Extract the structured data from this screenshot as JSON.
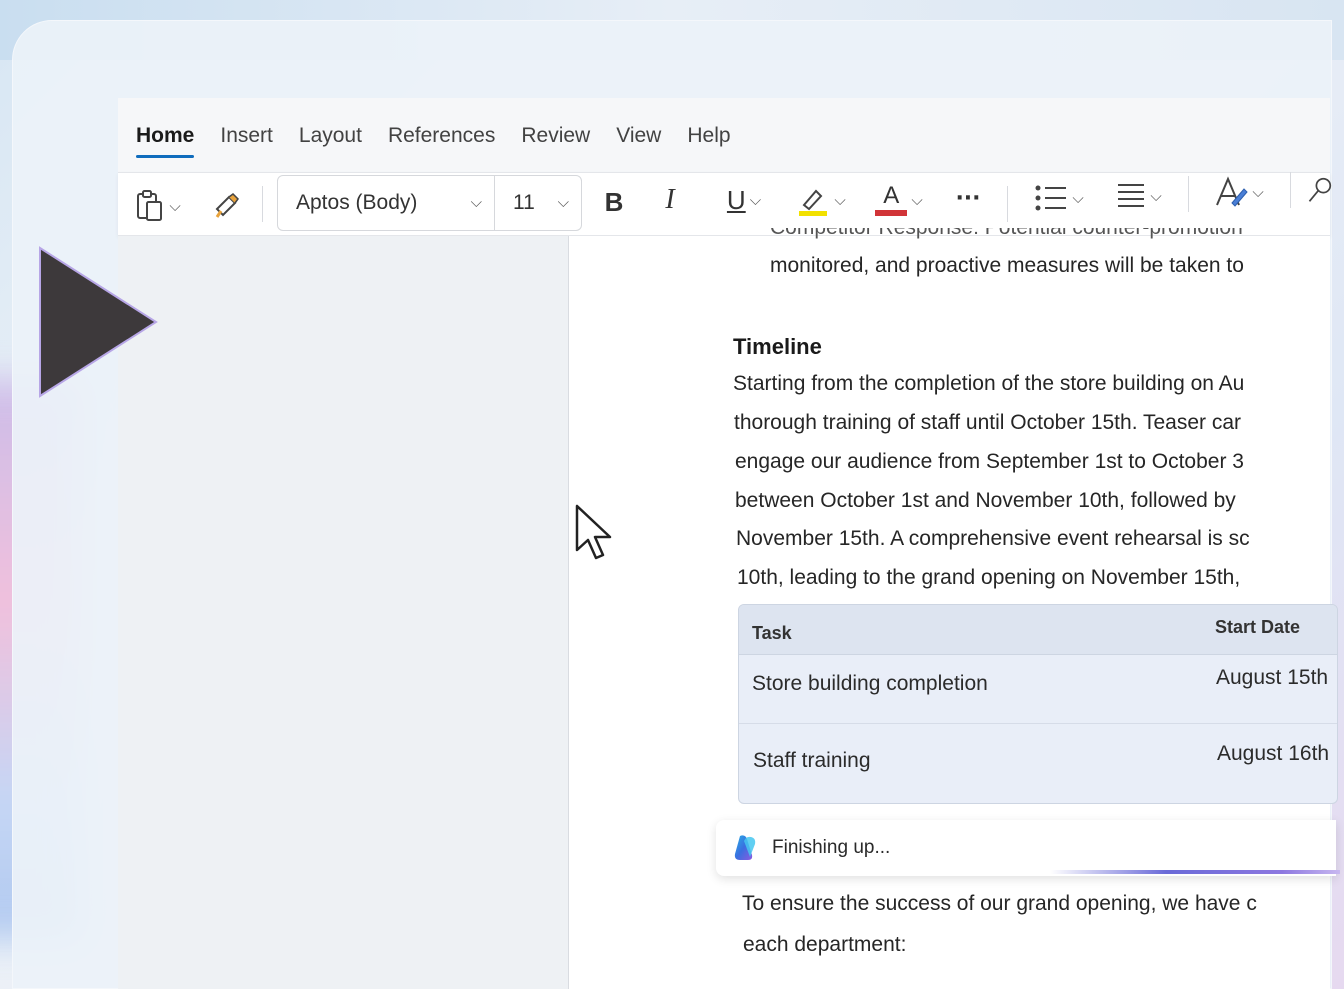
{
  "app": {
    "ribbon_tabs": [
      {
        "label": "Home",
        "active": true
      },
      {
        "label": "Insert",
        "active": false
      },
      {
        "label": "Layout",
        "active": false
      },
      {
        "label": "References",
        "active": false
      },
      {
        "label": "Review",
        "active": false
      },
      {
        "label": "View",
        "active": false
      },
      {
        "label": "Help",
        "active": false
      }
    ],
    "toolbar": {
      "font_name": "Aptos (Body)",
      "font_size": "11",
      "bold_glyph": "B",
      "italic_glyph": "I",
      "underline_glyph": "U",
      "font_color_glyph": "A",
      "more_glyph": "···",
      "highlight_color": "#f2e100",
      "font_color": "#d13438"
    }
  },
  "document": {
    "bullet_partial": "Competitor Response: Potential counter-promotion",
    "bullet_line2": "monitored, and proactive measures will be taken to",
    "heading": "Timeline",
    "para_lines": [
      "Starting from the completion of the store building on Au",
      "thorough training of staff until October 15th. Teaser car",
      "engage our audience from September 1st to October 3",
      "between October 1st and November 10th, followed by",
      "November 15th. A comprehensive event rehearsal is sc",
      "10th, leading to the grand opening on November 15th,"
    ],
    "table": {
      "headers": {
        "task": "Task",
        "start": "Start Date"
      },
      "rows": [
        {
          "task": "Store building completion",
          "start": "August 15th"
        },
        {
          "task": "Staff training",
          "start": "August 16th"
        }
      ]
    },
    "copilot_status": "Finishing up...",
    "closing_lines": [
      "To ensure the success of our grand opening, we have c",
      "each department:"
    ]
  },
  "icons": {
    "play": "play-icon",
    "cursor": "mouse-cursor-icon",
    "copilot": "copilot-icon"
  }
}
